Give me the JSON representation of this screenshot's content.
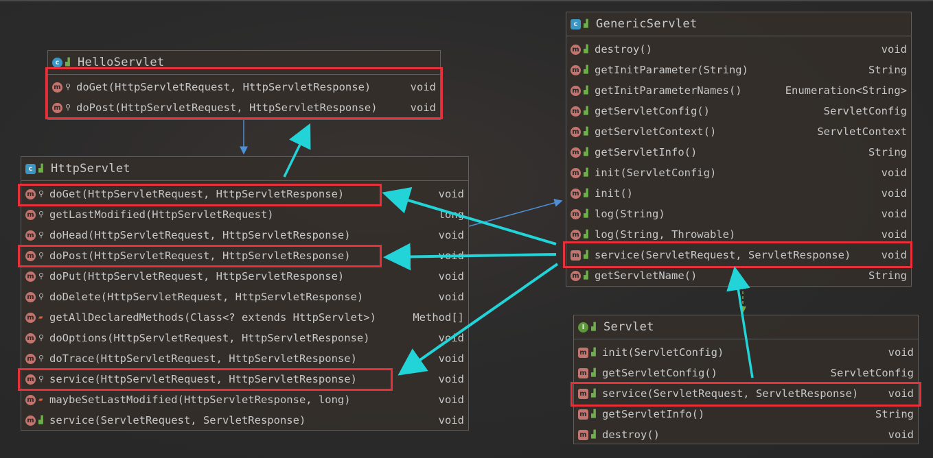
{
  "hello": {
    "title": "HelloServlet",
    "rows": [
      {
        "sig": "doGet(HttpServletRequest, HttpServletResponse)",
        "ret": "void"
      },
      {
        "sig": "doPost(HttpServletRequest, HttpServletResponse)",
        "ret": "void"
      }
    ]
  },
  "http": {
    "title": "HttpServlet",
    "rows": [
      {
        "sig": "doGet(HttpServletRequest, HttpServletResponse)",
        "ret": "void"
      },
      {
        "sig": "getLastModified(HttpServletRequest)",
        "ret": "long"
      },
      {
        "sig": "doHead(HttpServletRequest, HttpServletResponse)",
        "ret": "void"
      },
      {
        "sig": "doPost(HttpServletRequest, HttpServletResponse)",
        "ret": "void"
      },
      {
        "sig": "doPut(HttpServletRequest, HttpServletResponse)",
        "ret": "void"
      },
      {
        "sig": "doDelete(HttpServletRequest, HttpServletResponse)",
        "ret": "void"
      },
      {
        "sig": "getAllDeclaredMethods(Class<? extends HttpServlet>)",
        "ret": "Method[]"
      },
      {
        "sig": "doOptions(HttpServletRequest, HttpServletResponse)",
        "ret": "void"
      },
      {
        "sig": "doTrace(HttpServletRequest, HttpServletResponse)",
        "ret": "void"
      },
      {
        "sig": "service(HttpServletRequest, HttpServletResponse)",
        "ret": "void"
      },
      {
        "sig": "maybeSetLastModified(HttpServletResponse, long)",
        "ret": "void"
      },
      {
        "sig": "service(ServletRequest, ServletResponse)",
        "ret": "void"
      }
    ]
  },
  "generic": {
    "title": "GenericServlet",
    "rows": [
      {
        "sig": "destroy()",
        "ret": "void"
      },
      {
        "sig": "getInitParameter(String)",
        "ret": "String"
      },
      {
        "sig": "getInitParameterNames()",
        "ret": "Enumeration<String>"
      },
      {
        "sig": "getServletConfig()",
        "ret": "ServletConfig"
      },
      {
        "sig": "getServletContext()",
        "ret": "ServletContext"
      },
      {
        "sig": "getServletInfo()",
        "ret": "String"
      },
      {
        "sig": "init(ServletConfig)",
        "ret": "void"
      },
      {
        "sig": "init()",
        "ret": "void"
      },
      {
        "sig": "log(String)",
        "ret": "void"
      },
      {
        "sig": "log(String, Throwable)",
        "ret": "void"
      },
      {
        "sig": "service(ServletRequest, ServletResponse)",
        "ret": "void"
      },
      {
        "sig": "getServletName()",
        "ret": "String"
      }
    ]
  },
  "servlet": {
    "title": "Servlet",
    "rows": [
      {
        "sig": "init(ServletConfig)",
        "ret": "void"
      },
      {
        "sig": "getServletConfig()",
        "ret": "ServletConfig"
      },
      {
        "sig": "service(ServletRequest, ServletResponse)",
        "ret": "void"
      },
      {
        "sig": "getServletInfo()",
        "ret": "String"
      },
      {
        "sig": "destroy()",
        "ret": "void"
      }
    ]
  },
  "icons": {
    "class": "class-icon",
    "interface": "interface-icon",
    "method": "method-icon",
    "abstract_method": "abstract-method-icon",
    "public": "public-visibility-icon",
    "protected": "protected-key-icon",
    "private": "private-lock-icon"
  },
  "colors": {
    "highlight": "#e8303a",
    "callout_arrow": "#22d3d8",
    "inherit_arrow": "#4f8fd6",
    "implement_arrow": "#7aa83e"
  }
}
